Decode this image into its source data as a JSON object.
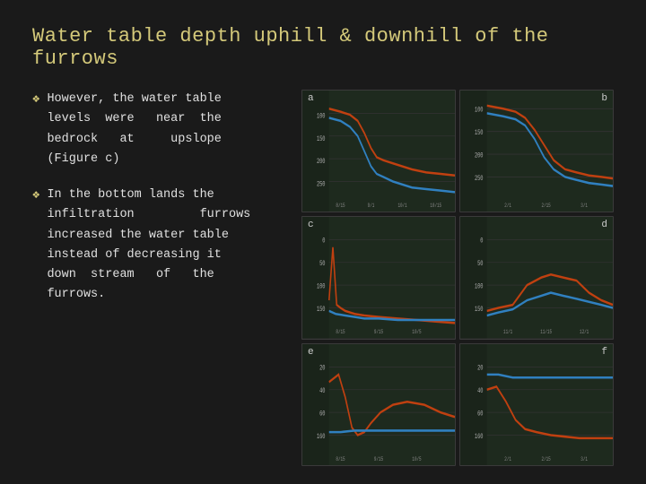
{
  "slide": {
    "title": "Water table depth uphill & downhill of the furrows",
    "bullets": [
      {
        "id": "bullet1",
        "text": "However, the water table levels were near the bedrock at upslope (Figure c)"
      },
      {
        "id": "bullet2",
        "text": "In the bottom lands the infiltration furrows increased the water table instead of decreasing it down stream of the furrows."
      }
    ],
    "charts": [
      {
        "id": "a",
        "label": "a"
      },
      {
        "id": "b",
        "label": "b"
      },
      {
        "id": "c",
        "label": "c"
      },
      {
        "id": "d",
        "label": "d"
      },
      {
        "id": "e",
        "label": "e"
      },
      {
        "id": "f",
        "label": "f"
      }
    ]
  }
}
